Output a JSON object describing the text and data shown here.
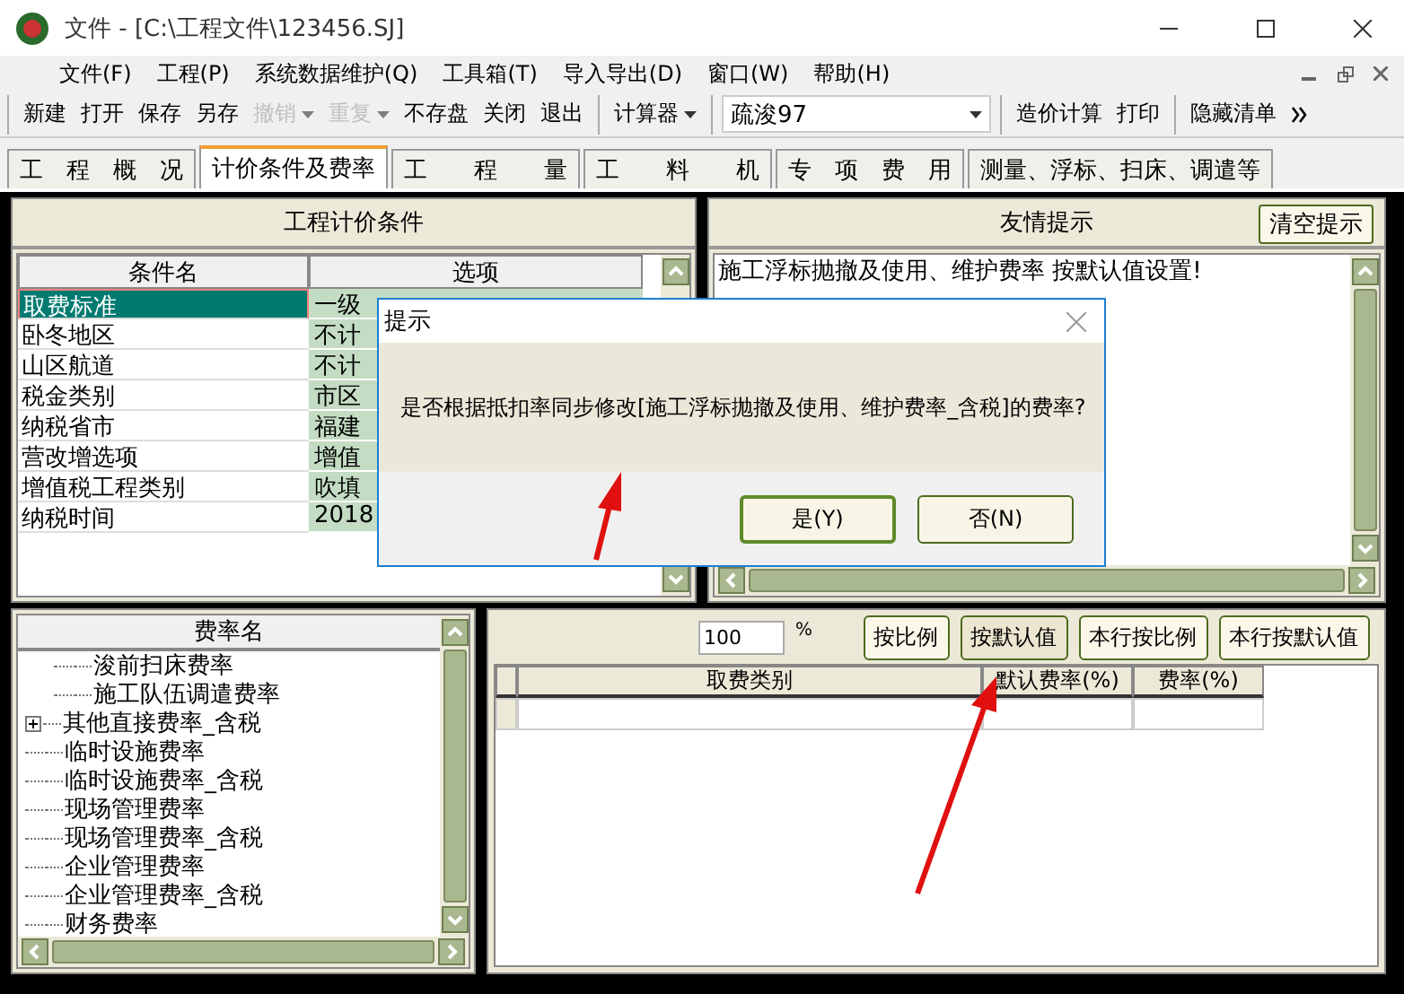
{
  "window": {
    "title": "文件 - [C:\\工程文件\\123456.SJ]"
  },
  "menu": [
    "文件(F)",
    "工程(P)",
    "系统数据维护(Q)",
    "工具箱(T)",
    "导入导出(D)",
    "窗口(W)",
    "帮助(H)"
  ],
  "toolbar": [
    [
      {
        "kind": "button",
        "label": "新建",
        "disabled": false
      },
      {
        "kind": "button",
        "label": "打开",
        "disabled": false
      },
      {
        "kind": "button",
        "label": "保存",
        "disabled": false
      },
      {
        "kind": "button",
        "label": "另存",
        "disabled": false
      },
      {
        "kind": "menu",
        "label": "撤销",
        "disabled": true
      },
      {
        "kind": "menu",
        "label": "重复",
        "disabled": true
      },
      {
        "kind": "button",
        "label": "不存盘",
        "disabled": false
      },
      {
        "kind": "button",
        "label": "关闭",
        "disabled": false
      },
      {
        "kind": "button",
        "label": "退出",
        "disabled": false
      }
    ],
    [
      {
        "kind": "menu",
        "label": "计算器",
        "disabled": false
      }
    ],
    [
      {
        "kind": "combo",
        "label": "疏浚97",
        "disabled": false
      }
    ],
    [
      {
        "kind": "button",
        "label": "造价计算",
        "disabled": false
      },
      {
        "kind": "button",
        "label": "打印",
        "disabled": false
      }
    ],
    [
      {
        "kind": "button",
        "label": "隐藏清单",
        "disabled": false
      }
    ]
  ],
  "tabs": [
    {
      "label": "工　程　概　况",
      "selected": false
    },
    {
      "label": "计价条件及费率",
      "selected": true
    },
    {
      "label": "工　　程　　量",
      "selected": false
    },
    {
      "label": "工　　料　　机",
      "selected": false
    },
    {
      "label": "专　项　费　用",
      "selected": false
    },
    {
      "label": "测量、浮标、扫床、调遣等",
      "selected": false
    }
  ],
  "conditions": {
    "title": "工程计价条件",
    "columns": [
      "条件名",
      "选项"
    ],
    "rows": [
      {
        "name": "取费标准",
        "option": "一级",
        "selected": true
      },
      {
        "name": "卧冬地区",
        "option": "不计",
        "selected": false
      },
      {
        "name": "山区航道",
        "option": "不计",
        "selected": false
      },
      {
        "name": "税金类别",
        "option": "市区",
        "selected": false
      },
      {
        "name": "纳税省市",
        "option": "福建",
        "selected": false
      },
      {
        "name": "营改增选项",
        "option": "增值",
        "selected": false
      },
      {
        "name": "增值税工程类别",
        "option": "吹填",
        "selected": false
      },
      {
        "name": "纳税时间",
        "option": "2018",
        "selected": false
      }
    ]
  },
  "tips": {
    "title": "友情提示",
    "clear_button": "清空提示",
    "text": "施工浮标抛撤及使用、维护费率  按默认值设置!"
  },
  "rates_tree": {
    "title": "费率名",
    "items": [
      {
        "children": [
          {
            "label": "浚前扫床费率"
          },
          {
            "label": "施工队伍调遣费率"
          }
        ]
      },
      {
        "label": "其他直接费率_含税",
        "expanded": false
      },
      {
        "label": "临时设施费率"
      },
      {
        "label": "临时设施费率_含税"
      },
      {
        "label": "现场管理费率"
      },
      {
        "label": "现场管理费率_含税"
      },
      {
        "label": "企业管理费率"
      },
      {
        "label": "企业管理费率_含税"
      },
      {
        "label": "财务费率"
      }
    ]
  },
  "rate_editor": {
    "percent_value": "100",
    "percent_sign": "%",
    "buttons": [
      {
        "label": "按比例",
        "selected": false
      },
      {
        "label": "按默认值",
        "selected": true
      },
      {
        "label": "本行按比例",
        "selected": false
      },
      {
        "label": "本行按默认值",
        "selected": false
      }
    ],
    "columns": [
      "取费类别",
      "默认费率(%)",
      "费率(%)"
    ]
  },
  "dialog": {
    "title": "提示",
    "message": "是否根据抵扣率同步修改[施工浮标抛撤及使用、维护费率_含税]的费率?",
    "buttons": [
      {
        "label": "是(Y)",
        "default": true
      },
      {
        "label": "否(N)",
        "default": false
      }
    ]
  }
}
